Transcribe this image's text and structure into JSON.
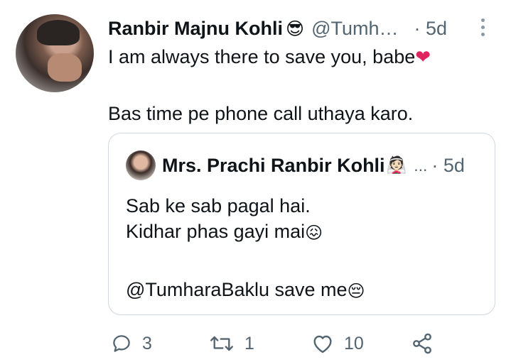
{
  "tweet": {
    "author": {
      "name": "Ranbir Majnu Kohli",
      "name_emoji": "😎",
      "handle": "@Tumh…",
      "time": "· 5d",
      "avatar": "avatar"
    },
    "lines": [
      "I am always there to save you, babe",
      "",
      "Bas time pe phone call uthaya karo."
    ],
    "line1_emoji": "❤"
  },
  "quote": {
    "author": {
      "name": "Mrs. Prachi Ranbir Kohli",
      "name_emoji": "👰🏻",
      "handle": "...",
      "time": "· 5d"
    },
    "lines": [
      "Sab ke sab pagal hai.",
      "Kidhar phas gayi mai",
      "",
      "@TumharaBaklu save me"
    ],
    "line2_emoji": "😖",
    "line4_emoji": "😔"
  },
  "actions": {
    "reply": {
      "icon": "reply-icon",
      "count": "3"
    },
    "retweet": {
      "icon": "retweet-icon",
      "count": "1"
    },
    "like": {
      "icon": "heart-icon",
      "count": "10"
    },
    "share": {
      "icon": "share-icon",
      "count": ""
    }
  },
  "colors": {
    "text": "#0f1419",
    "secondary": "#536471",
    "border": "#cfd9de",
    "heart": "#e0245e"
  }
}
